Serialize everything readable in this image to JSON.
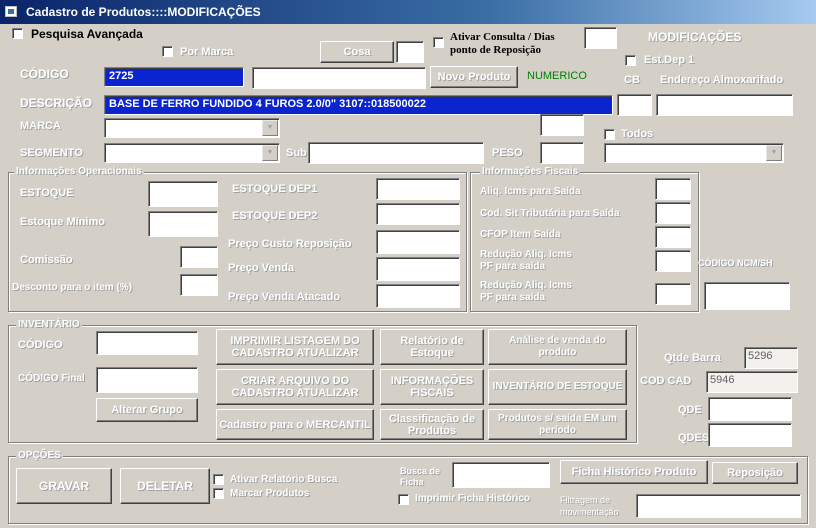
{
  "window": {
    "title": "Cadastro de Produtos::::MODIFICAÇÕES"
  },
  "top": {
    "pesquisa_avancada": "Pesquisa Avançada",
    "por_marca": "Por Marca",
    "cosa_btn": "Cosa",
    "ativar_consulta": "Ativar Consulta / Dias",
    "ponto_reposicao": "ponto de Reposição",
    "modificacoes": "MODIFICAÇÕES",
    "est_dep": "Est.Dep 1",
    "cb": "CB",
    "endereco": "Endereço Almoxarifado",
    "codigo_label": "CÓDIGO",
    "codigo_value": "2725",
    "novo_produto_btn": "Novo Produto",
    "numerico": "NUMERICO",
    "descricao_label": "DESCRIÇÃO",
    "descricao_value": "BASE DE FERRO FUNDIDO 4 FUROS 2.0/0\" 3107::018500022",
    "marca_label": "MARCA",
    "todos": "Todos",
    "segmento_label": "SEGMENTO",
    "sub_label": "Sub",
    "peso_label": "PESO"
  },
  "info_op": {
    "title": "Informações Operacionais",
    "estoque": "ESTOQUE",
    "estoque_minimo": "Estoque Mínimo",
    "comissao": "Comissão",
    "desconto": "Desconto para o item (%)",
    "estoque_dep1": "ESTOQUE DEP1",
    "estoque_dep2": "ESTOQUE DEP2",
    "preco_custo": "Preço Custo Reposição",
    "preco_venda": "Preço Venda",
    "preco_atacado": "Preço Venda Atacado"
  },
  "info_fiscal": {
    "title": "Informações Fiscais",
    "aliq_icms": "Aliq. Icms para Saída",
    "cod_sit": "Cod. Sit Tributária para Saída",
    "cfop": "CFOP Item Saída",
    "reducao": "Redução Aliq. Icms",
    "pf_saida": "PF para saída",
    "reducao2": "Redução Aliq. Icms",
    "pf_saida2": "PF para saída",
    "codigo_ncm": "CÓDIGO NCM/SH"
  },
  "inventario": {
    "title": "INVENTÁRIO",
    "codigo": "CÓDIGO",
    "codigo_final": "CÓDIGO Final",
    "alterar_grupo": "Alterar Grupo",
    "btn_imprimir": "IMPRIMIR LISTAGEM DO CADASTRO ATUALIZAR",
    "btn_criar": "CRIAR ARQUIVO DO CADASTRO ATUALIZAR",
    "btn_cadastro": "Cadastro para o MERCANTIL",
    "btn_relatorio": "Relatório de Estoque",
    "btn_informacoes": "INFORMAÇÕES FISCAIS",
    "btn_classificacao": "Classificação de Produtos",
    "btn_analise": "Análise de venda do produto",
    "btn_inventario": "INVENTÁRIO DE ESTOQUE",
    "btn_produtos": "Produtos s/ saída EM um período"
  },
  "right": {
    "qtde_barra": "Qtde Barra",
    "qtde_barra_value": "5296",
    "cod_cad": "COD CAD",
    "cod_cad_value": "5946",
    "qde": "QDE",
    "qdes": "QDES"
  },
  "opcoes": {
    "title": "OPÇÕES",
    "gravar": "GRAVAR",
    "deletar": "DELETAR",
    "ativar_relatorio": "Ativar Relatório Busca",
    "marcar_produtos": "Marcar Produtos",
    "busca_ficha": "Busca de Ficha",
    "ficha_historico_btn": "Ficha Histórico Produto",
    "reposicao_btn": "Reposição",
    "imprimir_ficha": "Imprimir Ficha Histórico",
    "filtragem": "Filtragem de",
    "movimentacao": "movimentação"
  }
}
